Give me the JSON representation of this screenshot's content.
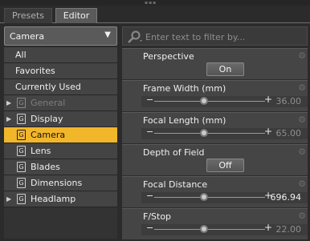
{
  "tabs": [
    {
      "label": "Presets"
    },
    {
      "label": "Editor"
    }
  ],
  "filter_dropdown": {
    "value": "Camera"
  },
  "nav_items": [
    {
      "label": "All"
    },
    {
      "label": "Favorites"
    },
    {
      "label": "Currently Used"
    },
    {
      "label": "General",
      "icon": "G",
      "disabled": true
    },
    {
      "label": "Display",
      "icon": "G"
    },
    {
      "label": "Camera",
      "icon": "G",
      "selected": true
    },
    {
      "label": "Lens",
      "icon": "G"
    },
    {
      "label": "Blades",
      "icon": "G"
    },
    {
      "label": "Dimensions",
      "icon": "G"
    },
    {
      "label": "Headlamp",
      "icon": "G"
    }
  ],
  "search": {
    "placeholder": "Enter text to filter by..."
  },
  "properties": [
    {
      "name": "Perspective",
      "type": "toggle",
      "value": "On"
    },
    {
      "name": "Frame Width (mm)",
      "type": "slider",
      "value": "36.00",
      "fraction": 0.45
    },
    {
      "name": "Focal Length (mm)",
      "type": "slider",
      "value": "65.00",
      "fraction": 0.45
    },
    {
      "name": "Depth of Field",
      "type": "toggle",
      "value": "Off"
    },
    {
      "name": "Focal Distance",
      "type": "slider",
      "value": "696.94",
      "fraction": 0.45
    },
    {
      "name": "F/Stop",
      "type": "slider",
      "value": "22.00",
      "fraction": 0.45
    }
  ],
  "colors": {
    "selection": "#f2b62a",
    "panel": "#454545",
    "background": "#2b2b2b"
  }
}
